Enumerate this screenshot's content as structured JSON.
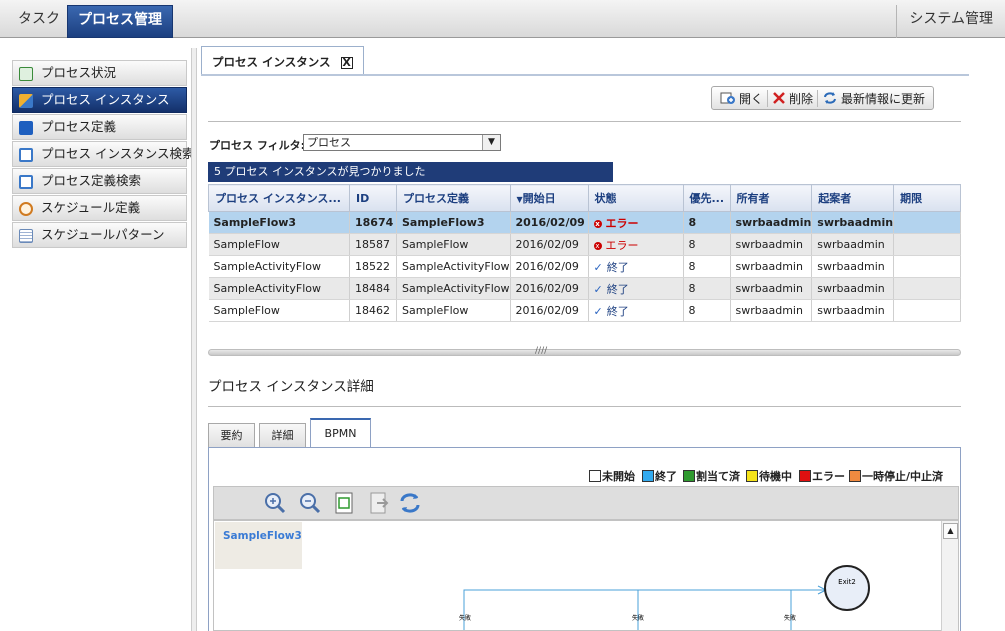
{
  "topbar": {
    "tab_task": "タスク",
    "tab_process": "プロセス管理",
    "system": "システム管理"
  },
  "nav": {
    "items": [
      {
        "label": "プロセス状況",
        "icon": "process-status-icon",
        "color": "#3a8a3a"
      },
      {
        "label": "プロセス インスタンス",
        "icon": "process-instance-icon",
        "color": "#e0a020"
      },
      {
        "label": "プロセス定義",
        "icon": "process-definition-icon",
        "color": "#1e5fbf"
      },
      {
        "label": "プロセス インスタンス検索",
        "icon": "instance-search-icon",
        "color": "#3a78c8"
      },
      {
        "label": "プロセス定義検索",
        "icon": "definition-search-icon",
        "color": "#3a78c8"
      },
      {
        "label": "スケジュール定義",
        "icon": "schedule-definition-icon",
        "color": "#d07a20"
      },
      {
        "label": "スケジュールパターン",
        "icon": "schedule-pattern-icon",
        "color": "#6a8ab8"
      }
    ]
  },
  "main_tab": {
    "label": "プロセス インスタンス",
    "close": "X"
  },
  "toolbar": {
    "open": "開く",
    "delete": "削除",
    "refresh": "最新情報に更新"
  },
  "filter": {
    "label": "プロセス フィルタ:",
    "value": "プロセス"
  },
  "found_text": "5 プロセス インスタンスが見つかりました",
  "table": {
    "headers": [
      "プロセス インスタンス...",
      "ID",
      "プロセス定義",
      "開始日",
      "状態",
      "優先...",
      "所有者",
      "起案者",
      "期限"
    ],
    "rows": [
      {
        "instance": "SampleFlow3",
        "id": "18674",
        "definition": "SampleFlow3",
        "start": "2016/02/09",
        "status": "エラー",
        "status_kind": "error",
        "priority": "8",
        "owner": "swrbaadmin",
        "initiator": "swrbaadmin",
        "due": ""
      },
      {
        "instance": "SampleFlow",
        "id": "18587",
        "definition": "SampleFlow",
        "start": "2016/02/09",
        "status": "エラー",
        "status_kind": "error",
        "priority": "8",
        "owner": "swrbaadmin",
        "initiator": "swrbaadmin",
        "due": ""
      },
      {
        "instance": "SampleActivityFlow",
        "id": "18522",
        "definition": "SampleActivityFlow",
        "start": "2016/02/09",
        "status": "終了",
        "status_kind": "done",
        "priority": "8",
        "owner": "swrbaadmin",
        "initiator": "swrbaadmin",
        "due": ""
      },
      {
        "instance": "SampleActivityFlow",
        "id": "18484",
        "definition": "SampleActivityFlow",
        "start": "2016/02/09",
        "status": "終了",
        "status_kind": "done",
        "priority": "8",
        "owner": "swrbaadmin",
        "initiator": "swrbaadmin",
        "due": ""
      },
      {
        "instance": "SampleFlow",
        "id": "18462",
        "definition": "SampleFlow",
        "start": "2016/02/09",
        "status": "終了",
        "status_kind": "done",
        "priority": "8",
        "owner": "swrbaadmin",
        "initiator": "swrbaadmin",
        "due": ""
      }
    ]
  },
  "detail": {
    "title": "プロセス インスタンス詳細"
  },
  "subtabs": [
    "要約",
    "詳細",
    "BPMN"
  ],
  "legend": [
    {
      "label": "未開始",
      "color": "#ffffff"
    },
    {
      "label": "終了",
      "color": "#33aaee"
    },
    {
      "label": "割当て済",
      "color": "#2f9a2f"
    },
    {
      "label": "待機中",
      "color": "#f5e31a"
    },
    {
      "label": "エラー",
      "color": "#e01010"
    },
    {
      "label": "一時停止/中止済",
      "color": "#f08a40"
    }
  ],
  "bpmn": {
    "flow_name": "SampleFlow3",
    "exit_label": "Exit2",
    "edge_label": "失敗"
  }
}
